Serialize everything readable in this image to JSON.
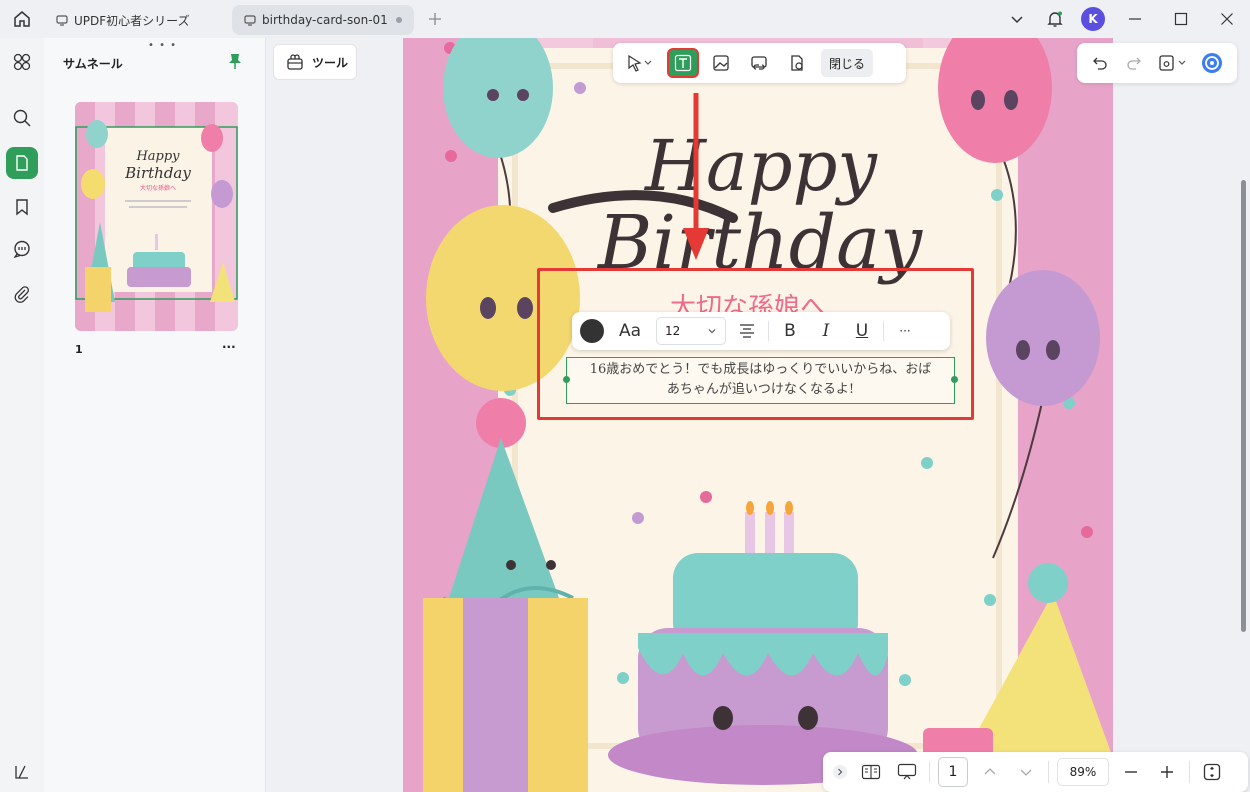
{
  "titlebar": {
    "tabs": [
      {
        "label": "UPDF初心者シリーズ",
        "active": false
      },
      {
        "label": "birthday-card-son-01",
        "active": true
      }
    ],
    "avatar_letter": "K"
  },
  "thumbnails": {
    "title": "サムネール",
    "page_number": "1",
    "more": "···"
  },
  "tools_button": {
    "label": "ツール"
  },
  "edit_toolbar": {
    "close_label": "閉じる"
  },
  "card": {
    "happy": "Happy",
    "birthday": "Birthday",
    "subtitle": "大切な孫娘へ",
    "body_line1": "16歳おめでとう！でも成長はゆっくりでいいからね、おば",
    "body_line2": "あちゃんが追いつけなくなるよ!"
  },
  "format_toolbar": {
    "font_icon": "Aa",
    "font_size": "12",
    "bold": "B",
    "italic": "I",
    "underline": "U",
    "more": "···"
  },
  "bottom_bar": {
    "page": "1",
    "zoom": "89%"
  },
  "colors": {
    "accent": "#2f9e5b",
    "highlight": "#e53935",
    "card_pink": "#e9a5c9"
  }
}
